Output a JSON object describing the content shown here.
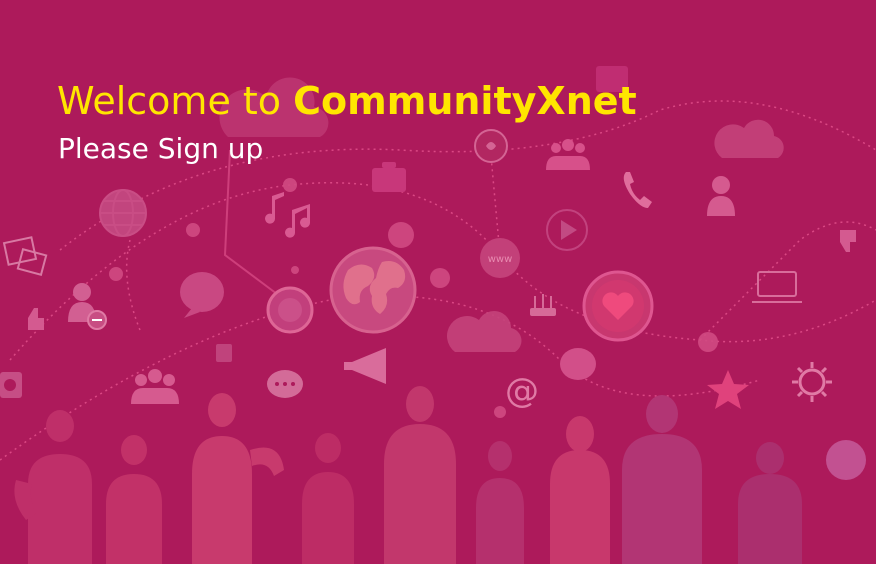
{
  "hero": {
    "welcome_prefix": "Welcome to ",
    "brand_name": "CommunityXnet",
    "subtitle": "Please Sign up"
  },
  "colors": {
    "background": "#ad1a5b",
    "accent": "#ffe600",
    "subtitle": "#ffffff"
  },
  "icons": [
    "cloud-icon",
    "globe-icon",
    "music-note-icon",
    "group-icon",
    "chat-bubble-icon",
    "phone-icon",
    "user-icon",
    "thumbs-down-icon",
    "thumbs-up-icon",
    "laptop-icon",
    "heart-icon",
    "star-icon",
    "gear-icon",
    "megaphone-icon",
    "at-sign-icon",
    "www-icon",
    "play-icon",
    "camera-icon",
    "photo-icon",
    "remove-user-icon",
    "router-icon",
    "briefcase-icon"
  ]
}
